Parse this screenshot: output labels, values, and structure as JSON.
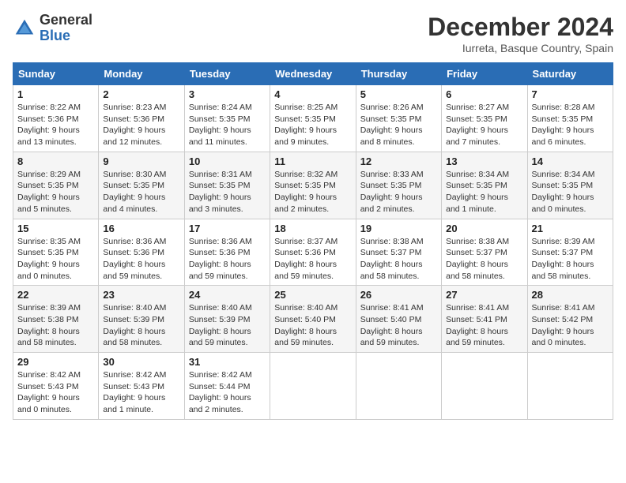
{
  "header": {
    "logo": {
      "general": "General",
      "blue": "Blue"
    },
    "title": "December 2024",
    "location": "Iurreta, Basque Country, Spain"
  },
  "calendar": {
    "days_of_week": [
      "Sunday",
      "Monday",
      "Tuesday",
      "Wednesday",
      "Thursday",
      "Friday",
      "Saturday"
    ],
    "weeks": [
      [
        null,
        {
          "day": "2",
          "sunrise": "Sunrise: 8:23 AM",
          "sunset": "Sunset: 5:36 PM",
          "daylight": "Daylight: 9 hours and 12 minutes."
        },
        {
          "day": "3",
          "sunrise": "Sunrise: 8:24 AM",
          "sunset": "Sunset: 5:35 PM",
          "daylight": "Daylight: 9 hours and 11 minutes."
        },
        {
          "day": "4",
          "sunrise": "Sunrise: 8:25 AM",
          "sunset": "Sunset: 5:35 PM",
          "daylight": "Daylight: 9 hours and 9 minutes."
        },
        {
          "day": "5",
          "sunrise": "Sunrise: 8:26 AM",
          "sunset": "Sunset: 5:35 PM",
          "daylight": "Daylight: 9 hours and 8 minutes."
        },
        {
          "day": "6",
          "sunrise": "Sunrise: 8:27 AM",
          "sunset": "Sunset: 5:35 PM",
          "daylight": "Daylight: 9 hours and 7 minutes."
        },
        {
          "day": "7",
          "sunrise": "Sunrise: 8:28 AM",
          "sunset": "Sunset: 5:35 PM",
          "daylight": "Daylight: 9 hours and 6 minutes."
        }
      ],
      [
        {
          "day": "1",
          "sunrise": "Sunrise: 8:22 AM",
          "sunset": "Sunset: 5:36 PM",
          "daylight": "Daylight: 9 hours and 13 minutes."
        },
        null,
        null,
        null,
        null,
        null,
        null
      ],
      [
        {
          "day": "8",
          "sunrise": "Sunrise: 8:29 AM",
          "sunset": "Sunset: 5:35 PM",
          "daylight": "Daylight: 9 hours and 5 minutes."
        },
        {
          "day": "9",
          "sunrise": "Sunrise: 8:30 AM",
          "sunset": "Sunset: 5:35 PM",
          "daylight": "Daylight: 9 hours and 4 minutes."
        },
        {
          "day": "10",
          "sunrise": "Sunrise: 8:31 AM",
          "sunset": "Sunset: 5:35 PM",
          "daylight": "Daylight: 9 hours and 3 minutes."
        },
        {
          "day": "11",
          "sunrise": "Sunrise: 8:32 AM",
          "sunset": "Sunset: 5:35 PM",
          "daylight": "Daylight: 9 hours and 2 minutes."
        },
        {
          "day": "12",
          "sunrise": "Sunrise: 8:33 AM",
          "sunset": "Sunset: 5:35 PM",
          "daylight": "Daylight: 9 hours and 2 minutes."
        },
        {
          "day": "13",
          "sunrise": "Sunrise: 8:34 AM",
          "sunset": "Sunset: 5:35 PM",
          "daylight": "Daylight: 9 hours and 1 minute."
        },
        {
          "day": "14",
          "sunrise": "Sunrise: 8:34 AM",
          "sunset": "Sunset: 5:35 PM",
          "daylight": "Daylight: 9 hours and 0 minutes."
        }
      ],
      [
        {
          "day": "15",
          "sunrise": "Sunrise: 8:35 AM",
          "sunset": "Sunset: 5:35 PM",
          "daylight": "Daylight: 9 hours and 0 minutes."
        },
        {
          "day": "16",
          "sunrise": "Sunrise: 8:36 AM",
          "sunset": "Sunset: 5:36 PM",
          "daylight": "Daylight: 8 hours and 59 minutes."
        },
        {
          "day": "17",
          "sunrise": "Sunrise: 8:36 AM",
          "sunset": "Sunset: 5:36 PM",
          "daylight": "Daylight: 8 hours and 59 minutes."
        },
        {
          "day": "18",
          "sunrise": "Sunrise: 8:37 AM",
          "sunset": "Sunset: 5:36 PM",
          "daylight": "Daylight: 8 hours and 59 minutes."
        },
        {
          "day": "19",
          "sunrise": "Sunrise: 8:38 AM",
          "sunset": "Sunset: 5:37 PM",
          "daylight": "Daylight: 8 hours and 58 minutes."
        },
        {
          "day": "20",
          "sunrise": "Sunrise: 8:38 AM",
          "sunset": "Sunset: 5:37 PM",
          "daylight": "Daylight: 8 hours and 58 minutes."
        },
        {
          "day": "21",
          "sunrise": "Sunrise: 8:39 AM",
          "sunset": "Sunset: 5:37 PM",
          "daylight": "Daylight: 8 hours and 58 minutes."
        }
      ],
      [
        {
          "day": "22",
          "sunrise": "Sunrise: 8:39 AM",
          "sunset": "Sunset: 5:38 PM",
          "daylight": "Daylight: 8 hours and 58 minutes."
        },
        {
          "day": "23",
          "sunrise": "Sunrise: 8:40 AM",
          "sunset": "Sunset: 5:39 PM",
          "daylight": "Daylight: 8 hours and 58 minutes."
        },
        {
          "day": "24",
          "sunrise": "Sunrise: 8:40 AM",
          "sunset": "Sunset: 5:39 PM",
          "daylight": "Daylight: 8 hours and 59 minutes."
        },
        {
          "day": "25",
          "sunrise": "Sunrise: 8:40 AM",
          "sunset": "Sunset: 5:40 PM",
          "daylight": "Daylight: 8 hours and 59 minutes."
        },
        {
          "day": "26",
          "sunrise": "Sunrise: 8:41 AM",
          "sunset": "Sunset: 5:40 PM",
          "daylight": "Daylight: 8 hours and 59 minutes."
        },
        {
          "day": "27",
          "sunrise": "Sunrise: 8:41 AM",
          "sunset": "Sunset: 5:41 PM",
          "daylight": "Daylight: 8 hours and 59 minutes."
        },
        {
          "day": "28",
          "sunrise": "Sunrise: 8:41 AM",
          "sunset": "Sunset: 5:42 PM",
          "daylight": "Daylight: 9 hours and 0 minutes."
        }
      ],
      [
        {
          "day": "29",
          "sunrise": "Sunrise: 8:42 AM",
          "sunset": "Sunset: 5:43 PM",
          "daylight": "Daylight: 9 hours and 0 minutes."
        },
        {
          "day": "30",
          "sunrise": "Sunrise: 8:42 AM",
          "sunset": "Sunset: 5:43 PM",
          "daylight": "Daylight: 9 hours and 1 minute."
        },
        {
          "day": "31",
          "sunrise": "Sunrise: 8:42 AM",
          "sunset": "Sunset: 5:44 PM",
          "daylight": "Daylight: 9 hours and 2 minutes."
        },
        null,
        null,
        null,
        null
      ]
    ]
  }
}
